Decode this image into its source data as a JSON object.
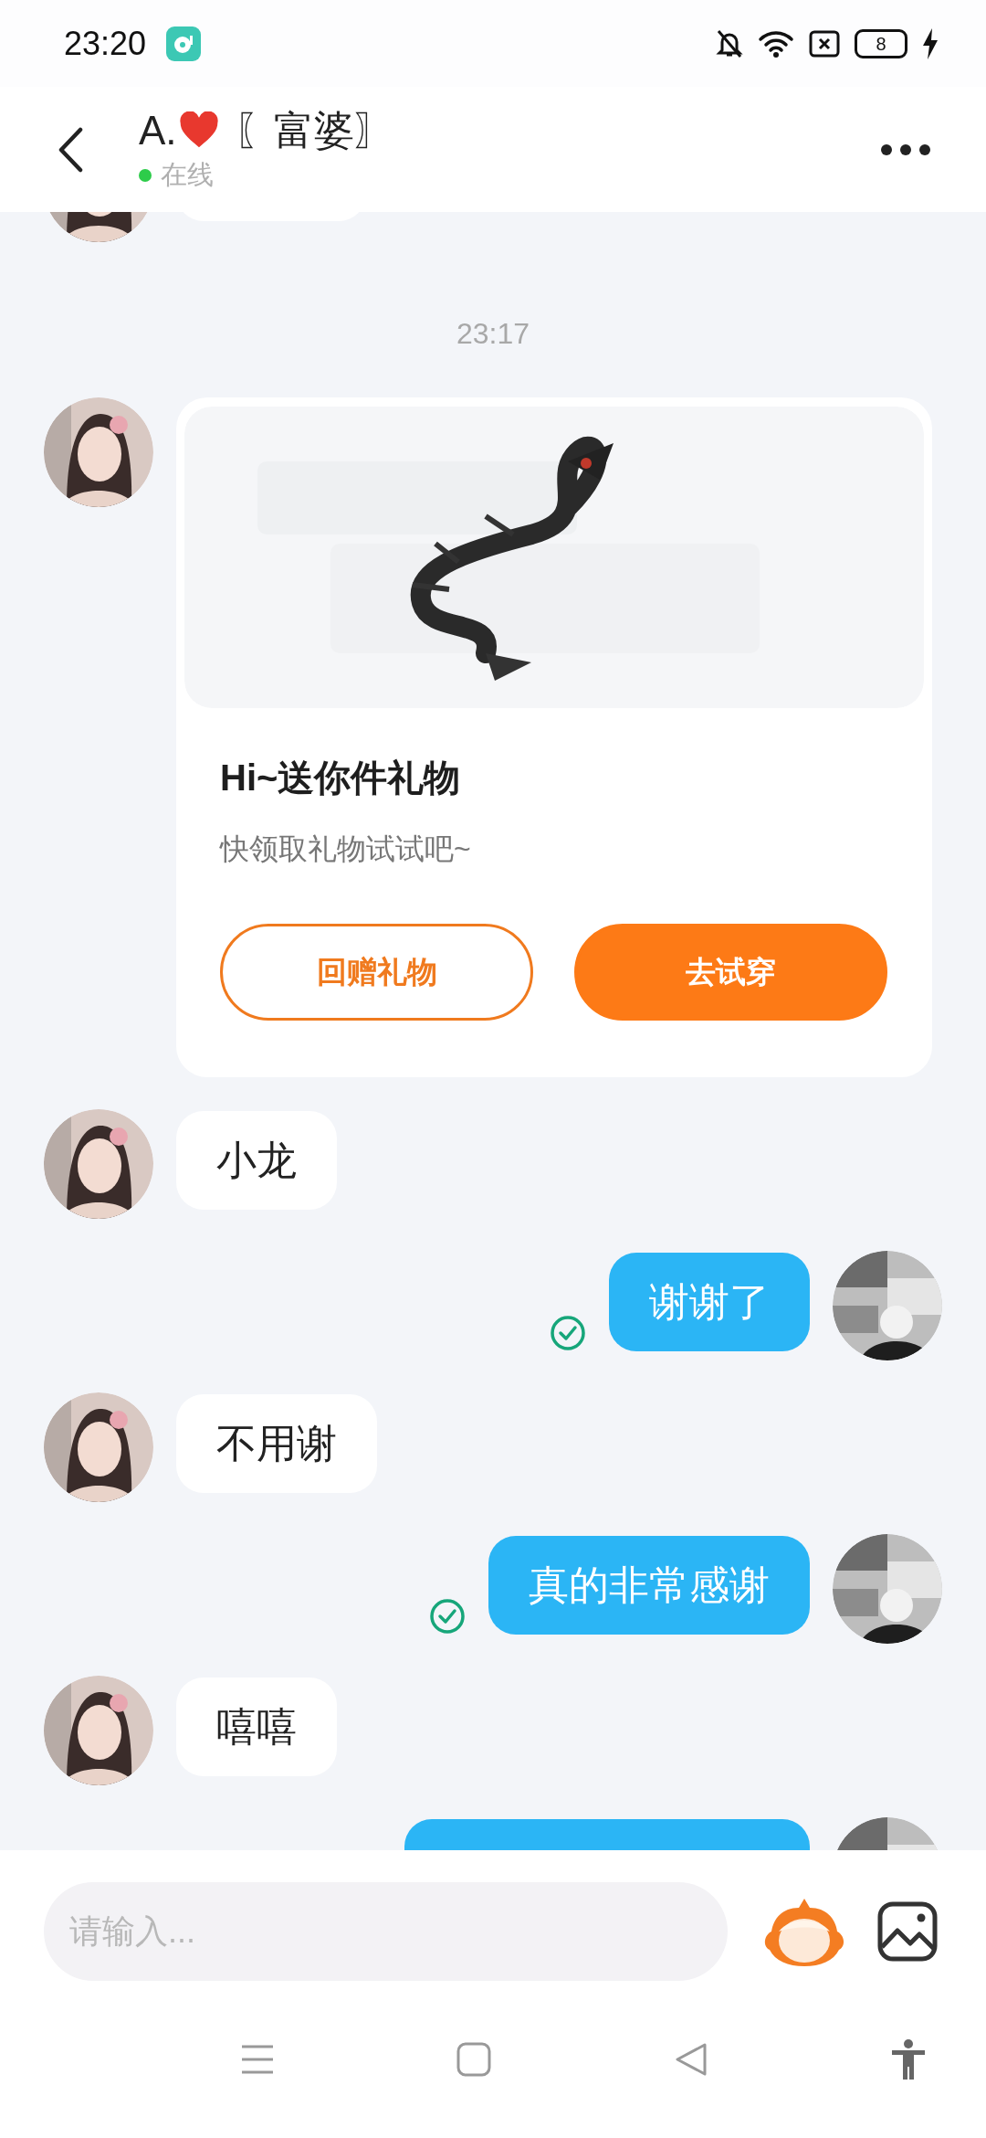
{
  "status_bar": {
    "time": "23:20",
    "battery": "8"
  },
  "header": {
    "title_prefix": "A.",
    "title_suffix": "〖富婆〗",
    "status": "在线",
    "online": true
  },
  "messages": [
    {
      "kind": "received",
      "cut": true
    },
    {
      "kind": "time",
      "text": "23:17"
    },
    {
      "kind": "gift",
      "title": "Hi~送你件礼物",
      "subtitle": "快领取礼物试试吧~",
      "buttons": [
        {
          "label": "回赠礼物",
          "kind": "outline"
        },
        {
          "label": "去试穿",
          "kind": "filled"
        }
      ]
    },
    {
      "kind": "received",
      "text": "小龙"
    },
    {
      "kind": "sent",
      "text": "谢谢了",
      "read": true
    },
    {
      "kind": "received",
      "text": "不用谢"
    },
    {
      "kind": "sent",
      "text": "真的非常感谢",
      "read": true
    },
    {
      "kind": "received",
      "text": "嘻嘻"
    },
    {
      "kind": "sent",
      "cut": true,
      "read": false
    }
  ],
  "input": {
    "placeholder": "请输入..."
  }
}
